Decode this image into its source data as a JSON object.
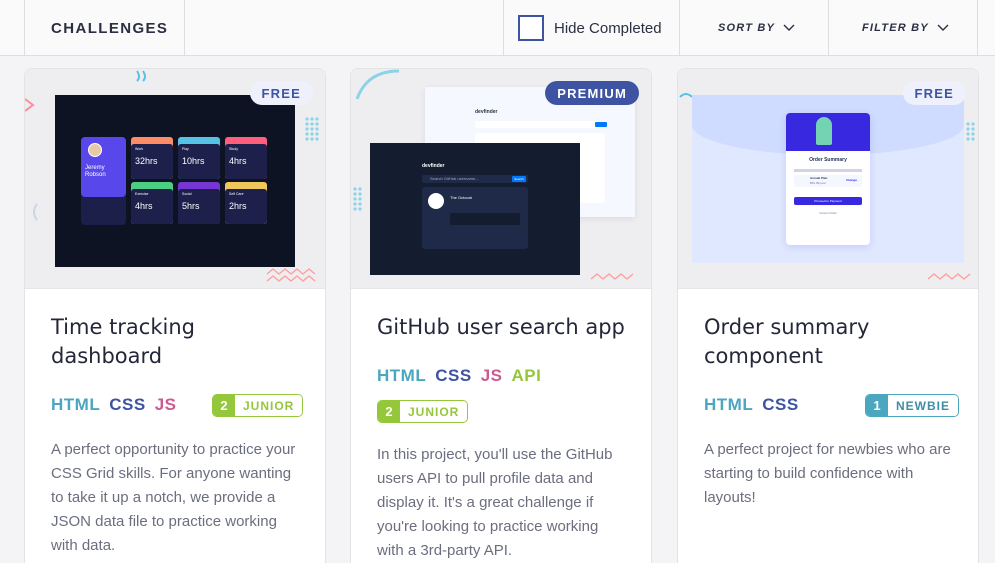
{
  "header": {
    "title": "CHALLENGES",
    "hide_completed_label": "Hide Completed",
    "sort_label": "SORT BY",
    "filter_label": "FILTER BY"
  },
  "cards": [
    {
      "badge": "FREE",
      "title": "Time tracking dashboard",
      "languages": [
        "HTML",
        "CSS",
        "JS"
      ],
      "level_number": "2",
      "level_label": "JUNIOR",
      "description": "A perfect opportunity to practice your CSS Grid skills. For anyone wanting to take it up a notch, we provide a JSON data file to practice working with data.",
      "preview": {
        "name": "Jeremy Robson",
        "tiles": [
          {
            "label": "Work",
            "hours": "32hrs",
            "color": "#ff8c66"
          },
          {
            "label": "Play",
            "hours": "10hrs",
            "color": "#56c2e6"
          },
          {
            "label": "Study",
            "hours": "4hrs",
            "color": "#ff5e7d"
          },
          {
            "label": "Exercise",
            "hours": "4hrs",
            "color": "#4bcf82"
          },
          {
            "label": "Social",
            "hours": "5hrs",
            "color": "#7536d3"
          },
          {
            "label": "Self Care",
            "hours": "2hrs",
            "color": "#f1c75b"
          }
        ]
      }
    },
    {
      "badge": "PREMIUM",
      "title": "GitHub user search app",
      "languages": [
        "HTML",
        "CSS",
        "JS",
        "API"
      ],
      "level_number": "2",
      "level_label": "JUNIOR",
      "description": "In this project, you'll use the GitHub users API to pull profile data and display it. It's a great challenge if you're looking to practice working with a 3rd-party API.",
      "preview": {
        "app_name": "devfinder",
        "search_placeholder": "Search GitHub username...",
        "search_button": "Search",
        "user_name": "The Octocat"
      }
    },
    {
      "badge": "FREE",
      "title": "Order summary component",
      "languages": [
        "HTML",
        "CSS"
      ],
      "level_number": "1",
      "level_label": "NEWBIE",
      "description": "A perfect project for newbies who are starting to build confidence with layouts!",
      "preview": {
        "heading": "Order Summary",
        "plan": "Annual Plan",
        "price": "$59.99/year",
        "change_link": "Change",
        "proceed_button": "Proceed to Payment",
        "cancel_link": "Cancel Order"
      }
    }
  ]
}
